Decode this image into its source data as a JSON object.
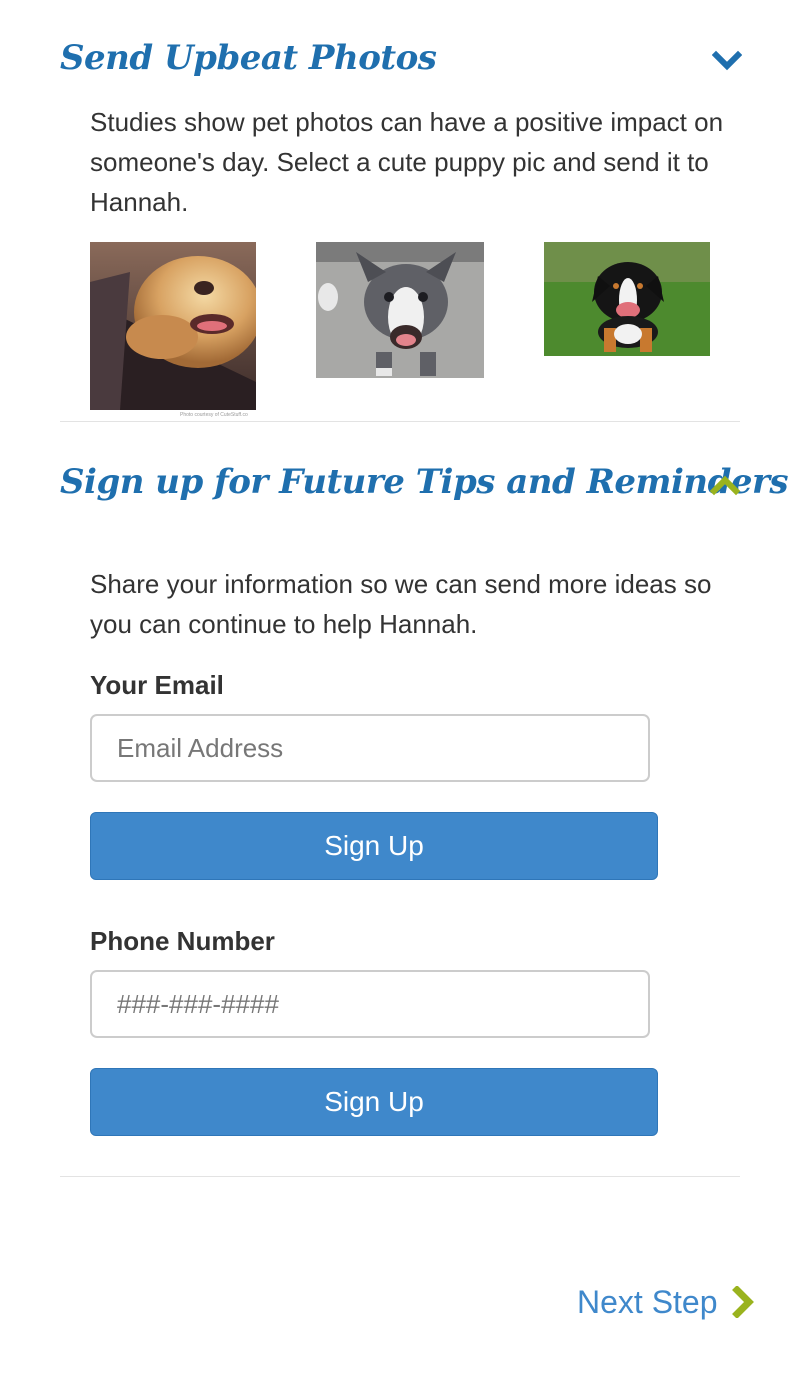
{
  "photos_section": {
    "title": "Send Upbeat Photos",
    "toggle_icon": "chevron-down-icon",
    "description": "Studies show pet photos can have a positive impact on someone's day. Select a cute puppy pic and send it to Hannah.",
    "photo_1_caption": "Photo courtesy of CuteStuff.co"
  },
  "signup_section": {
    "title": "Sign up for Future Tips and Reminders",
    "toggle_icon": "chevron-up-icon",
    "description": "Share your information so we can send more ideas so you can continue to help Hannah.",
    "email_label": "Your Email",
    "email_placeholder": "Email Address",
    "email_button": "Sign Up",
    "phone_label": "Phone Number",
    "phone_placeholder": "###-###-####",
    "phone_button": "Sign Up"
  },
  "navigation": {
    "next_label": "Next Step",
    "next_icon": "chevron-right-icon"
  },
  "colors": {
    "title_blue": "#1f6fae",
    "button_blue": "#3f88cb",
    "accent_green": "#9ab31e",
    "text": "#333333"
  }
}
